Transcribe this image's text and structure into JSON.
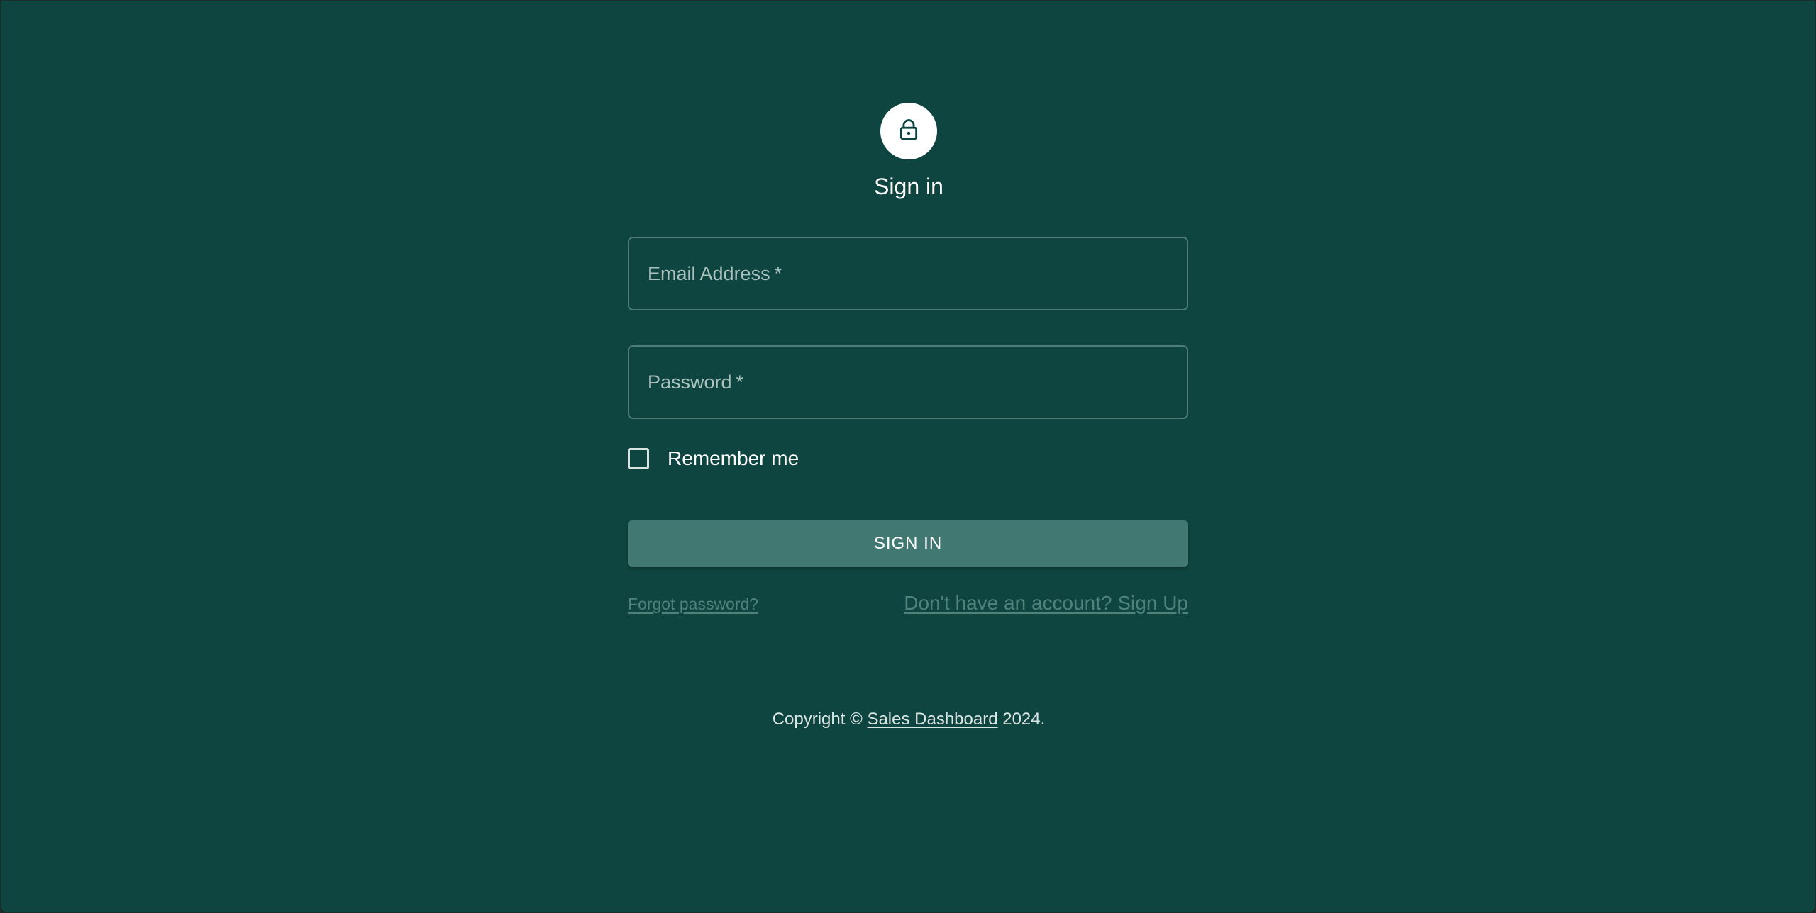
{
  "colors": {
    "background": "#0f4540",
    "button": "#417872",
    "field_border": "#4f7c76",
    "link": "#4f827b",
    "text": "#ffffff"
  },
  "header": {
    "icon": "lock-icon",
    "title": "Sign in"
  },
  "form": {
    "email": {
      "label": "Email Address",
      "required_mark": "*",
      "value": ""
    },
    "password": {
      "label": "Password",
      "required_mark": "*",
      "value": ""
    },
    "remember": {
      "label": "Remember me",
      "checked": false
    },
    "submit_label": "SIGN IN"
  },
  "links": {
    "forgot": "Forgot password?",
    "signup": "Don't have an account? Sign Up"
  },
  "footer": {
    "prefix": "Copyright ©",
    "link": "Sales Dashboard",
    "suffix": "2024."
  }
}
